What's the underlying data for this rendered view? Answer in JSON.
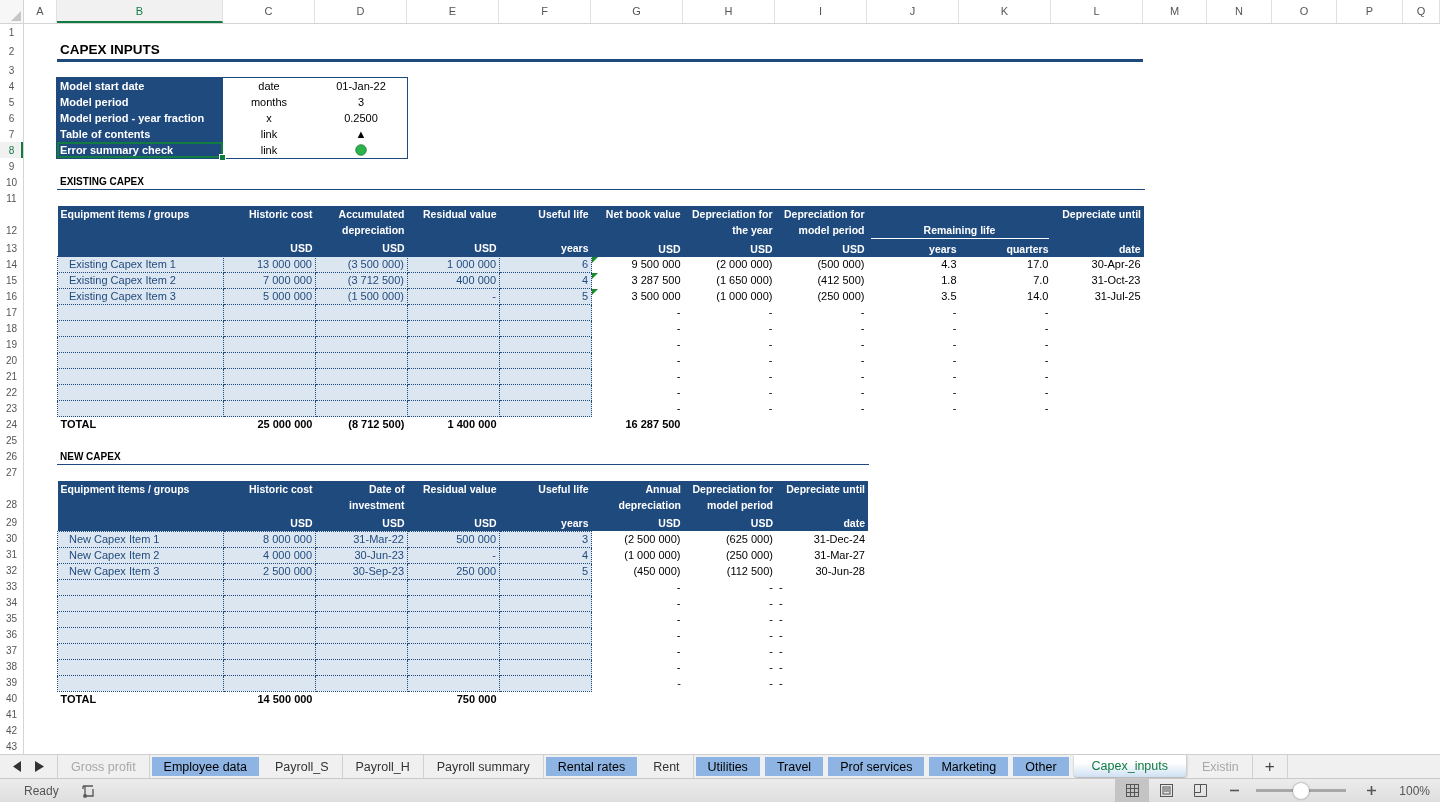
{
  "column_headers": [
    {
      "label": "A",
      "selected": false
    },
    {
      "label": "B",
      "selected": true
    },
    {
      "label": "C",
      "selected": false
    },
    {
      "label": "D",
      "selected": false
    },
    {
      "label": "E",
      "selected": false
    },
    {
      "label": "F",
      "selected": false
    },
    {
      "label": "G",
      "selected": false
    },
    {
      "label": "H",
      "selected": false
    },
    {
      "label": "I",
      "selected": false
    },
    {
      "label": "J",
      "selected": false
    },
    {
      "label": "K",
      "selected": false
    },
    {
      "label": "L",
      "selected": false
    },
    {
      "label": "M",
      "selected": false
    },
    {
      "label": "N",
      "selected": false
    },
    {
      "label": "O",
      "selected": false
    },
    {
      "label": "P",
      "selected": false
    },
    {
      "label": "Q",
      "selected": false
    }
  ],
  "row_numbers": [
    {
      "label": "1",
      "selected": false
    },
    {
      "label": "2",
      "selected": false
    },
    {
      "label": "3",
      "selected": false
    },
    {
      "label": "4",
      "selected": false
    },
    {
      "label": "5",
      "selected": false
    },
    {
      "label": "6",
      "selected": false
    },
    {
      "label": "7",
      "selected": false
    },
    {
      "label": "8",
      "selected": true
    },
    {
      "label": "9",
      "selected": false
    },
    {
      "label": "10",
      "selected": false
    },
    {
      "label": "11",
      "selected": false
    },
    {
      "label": "12",
      "selected": false
    },
    {
      "label": "13",
      "selected": false
    },
    {
      "label": "14",
      "selected": false
    },
    {
      "label": "15",
      "selected": false
    },
    {
      "label": "16",
      "selected": false
    },
    {
      "label": "17",
      "selected": false
    },
    {
      "label": "18",
      "selected": false
    },
    {
      "label": "19",
      "selected": false
    },
    {
      "label": "20",
      "selected": false
    },
    {
      "label": "21",
      "selected": false
    },
    {
      "label": "22",
      "selected": false
    },
    {
      "label": "23",
      "selected": false
    },
    {
      "label": "24",
      "selected": false
    },
    {
      "label": "25",
      "selected": false
    },
    {
      "label": "26",
      "selected": false
    },
    {
      "label": "27",
      "selected": false
    },
    {
      "label": "28",
      "selected": false
    },
    {
      "label": "29",
      "selected": false
    },
    {
      "label": "30",
      "selected": false
    },
    {
      "label": "31",
      "selected": false
    },
    {
      "label": "32",
      "selected": false
    },
    {
      "label": "33",
      "selected": false
    },
    {
      "label": "34",
      "selected": false
    },
    {
      "label": "35",
      "selected": false
    },
    {
      "label": "36",
      "selected": false
    },
    {
      "label": "37",
      "selected": false
    },
    {
      "label": "38",
      "selected": false
    },
    {
      "label": "39",
      "selected": false
    },
    {
      "label": "40",
      "selected": false
    },
    {
      "label": "41",
      "selected": false
    },
    {
      "label": "42",
      "selected": false
    },
    {
      "label": "43",
      "selected": false
    }
  ],
  "title": "CAPEX INPUTS",
  "settings": [
    {
      "label": "Model start date",
      "unit": "date",
      "kind": "text",
      "value": "01-Jan-22",
      "selected": false
    },
    {
      "label": "Model period",
      "unit": "months",
      "kind": "text",
      "value": "3",
      "selected": false
    },
    {
      "label": "Model period - year fraction",
      "unit": "x",
      "kind": "text",
      "value": "0.2500",
      "selected": false
    },
    {
      "label": "Table of contents",
      "unit": "link",
      "kind": "text",
      "value": "▲",
      "selected": false
    },
    {
      "label": "Error summary check",
      "unit": "link",
      "kind": "dot",
      "color": "#2cb34a",
      "selected": true
    }
  ],
  "existing_capex": {
    "heading": "EXISTING CAPEX",
    "group_header": "Remaining life",
    "columns": [
      {
        "label": "Equipment items / groups",
        "kind": "input"
      },
      {
        "label": "Historic cost",
        "unit": "USD",
        "kind": "input"
      },
      {
        "label": "Accumulated\ndepreciation",
        "unit": "USD",
        "kind": "input"
      },
      {
        "label": "Residual value",
        "unit": "USD",
        "kind": "input"
      },
      {
        "label": "Useful life",
        "unit": "years",
        "kind": "input"
      },
      {
        "label": "Net book value",
        "unit": "USD",
        "kind": "output"
      },
      {
        "label": "Depreciation for\nthe year",
        "unit": "USD",
        "kind": "output"
      },
      {
        "label": "Depreciation for\nmodel period",
        "unit": "USD",
        "kind": "output"
      },
      {
        "unit": "years",
        "kind": "output"
      },
      {
        "unit": "quarters",
        "kind": "output"
      },
      {
        "label": "Depreciate until",
        "unit": "date",
        "kind": "date"
      }
    ],
    "rows": [
      {
        "inputs": [
          "Existing Capex Item 1",
          "13 000 000",
          "(3 500 000)",
          "1 000 000",
          "6"
        ],
        "outputs": [
          "9 500 000",
          "(2 000 000)",
          "(500 000)",
          "4.3",
          "17.0",
          "30-Apr-26"
        ],
        "flagged": true
      },
      {
        "inputs": [
          "Existing Capex Item 2",
          "7 000 000",
          "(3 712 500)",
          "400 000",
          "4"
        ],
        "outputs": [
          "3 287 500",
          "(1 650 000)",
          "(412 500)",
          "1.8",
          "7.0",
          "31-Oct-23"
        ],
        "flagged": true
      },
      {
        "inputs": [
          "Existing Capex Item 3",
          "5 000 000",
          "(1 500 000)",
          "-",
          "5"
        ],
        "outputs": [
          "3 500 000",
          "(1 000 000)",
          "(250 000)",
          "3.5",
          "14.0",
          "31-Jul-25"
        ],
        "flagged": true
      },
      {
        "outputs": [
          "-",
          "-",
          "-",
          "-",
          "-"
        ],
        "flagged": false
      },
      {
        "outputs": [
          "-",
          "-",
          "-",
          "-",
          "-"
        ],
        "flagged": false
      },
      {
        "outputs": [
          "-",
          "-",
          "-",
          "-",
          "-"
        ],
        "flagged": false
      },
      {
        "outputs": [
          "-",
          "-",
          "-",
          "-",
          "-"
        ],
        "flagged": false
      },
      {
        "outputs": [
          "-",
          "-",
          "-",
          "-",
          "-"
        ],
        "flagged": false
      },
      {
        "outputs": [
          "-",
          "-",
          "-",
          "-",
          "-"
        ],
        "flagged": false
      },
      {
        "outputs": [
          "-",
          "-",
          "-",
          "-",
          "-"
        ],
        "flagged": false
      }
    ],
    "total": {
      "label": "TOTAL",
      "values": [
        {
          "kind": "value",
          "value": "25 000 000"
        },
        {
          "kind": "value",
          "value": "(8 712 500)"
        },
        {
          "kind": "value",
          "value": "1 400 000"
        },
        {
          "kind": "blank"
        },
        {
          "kind": "value",
          "value": "16 287 500"
        }
      ]
    }
  },
  "new_capex": {
    "heading": "NEW CAPEX",
    "columns": [
      {
        "label": "Equipment items / groups",
        "kind": "input"
      },
      {
        "label": "Historic cost",
        "unit": "USD",
        "kind": "input"
      },
      {
        "label": "Date of\ninvestment",
        "unit": "USD",
        "kind": "input"
      },
      {
        "label": "Residual value",
        "unit": "USD",
        "kind": "input"
      },
      {
        "label": "Useful life",
        "unit": "years",
        "kind": "input"
      },
      {
        "label": "Annual\ndepreciation",
        "unit": "USD",
        "kind": "output"
      },
      {
        "label": "Depreciation for\nmodel period",
        "unit": "USD",
        "kind": "output"
      },
      {
        "label": "Depreciate until",
        "unit": "date",
        "kind": "date"
      }
    ],
    "rows": [
      {
        "inputs": [
          "New Capex Item 1",
          "8 000 000",
          "31-Mar-22",
          "500 000",
          "3"
        ],
        "outputs": [
          "(2 500 000)",
          "(625 000)",
          "31-Dec-24"
        ]
      },
      {
        "inputs": [
          "New Capex Item 2",
          "4 000 000",
          "30-Jun-23",
          "-",
          "4"
        ],
        "outputs": [
          "(1 000 000)",
          "(250 000)",
          "31-Mar-27"
        ]
      },
      {
        "inputs": [
          "New Capex Item 3",
          "2 500 000",
          "30-Sep-23",
          "250 000",
          "5"
        ],
        "outputs": [
          "(450 000)",
          "(112 500)",
          "30-Jun-28"
        ]
      },
      {
        "outputs": [
          "-",
          "-",
          "-"
        ]
      },
      {
        "outputs": [
          "-",
          "-",
          "-"
        ]
      },
      {
        "outputs": [
          "-",
          "-",
          "-"
        ]
      },
      {
        "outputs": [
          "-",
          "-",
          "-"
        ]
      },
      {
        "outputs": [
          "-",
          "-",
          "-"
        ]
      },
      {
        "outputs": [
          "-",
          "-",
          "-"
        ]
      },
      {
        "outputs": [
          "-",
          "-",
          "-"
        ]
      }
    ],
    "total": {
      "label": "TOTAL",
      "values": [
        {
          "kind": "value",
          "value": "14 500 000"
        },
        {
          "kind": "blank"
        },
        {
          "kind": "value",
          "value": "750 000"
        }
      ]
    }
  },
  "tabs": [
    {
      "label": "Gross profit",
      "selected": false,
      "faded": true
    },
    {
      "label": "Employee data",
      "color": "#8db4e2",
      "selected": false,
      "faded": false
    },
    {
      "label": "Payroll_S",
      "selected": false,
      "faded": false
    },
    {
      "label": "Payroll_H",
      "selected": false,
      "faded": false
    },
    {
      "label": "Payroll summary",
      "selected": false,
      "faded": false
    },
    {
      "label": "Rental rates",
      "color": "#8db4e2",
      "selected": false,
      "faded": false
    },
    {
      "label": "Rent",
      "selected": false,
      "faded": false
    },
    {
      "label": "Utilities",
      "color": "#8db4e2",
      "selected": false,
      "faded": false
    },
    {
      "label": "Travel",
      "color": "#8db4e2",
      "selected": false,
      "faded": false
    },
    {
      "label": "Prof services",
      "color": "#8db4e2",
      "selected": false,
      "faded": false
    },
    {
      "label": "Marketing",
      "color": "#8db4e2",
      "selected": false,
      "faded": false
    },
    {
      "label": "Other",
      "color": "#8db4e2",
      "selected": false,
      "faded": false
    },
    {
      "label": "Capex_inputs",
      "selected": true,
      "faded": false
    },
    {
      "label": "Existin",
      "selected": false,
      "faded": true
    }
  ],
  "add_sheet": "+",
  "status_bar": {
    "status": "Ready",
    "views": [
      {
        "kind": "normal",
        "selected": true
      },
      {
        "kind": "page_layout",
        "selected": false
      },
      {
        "kind": "page_break",
        "selected": false
      }
    ],
    "zoom": {
      "level": 0.5,
      "reading": "100%"
    }
  }
}
